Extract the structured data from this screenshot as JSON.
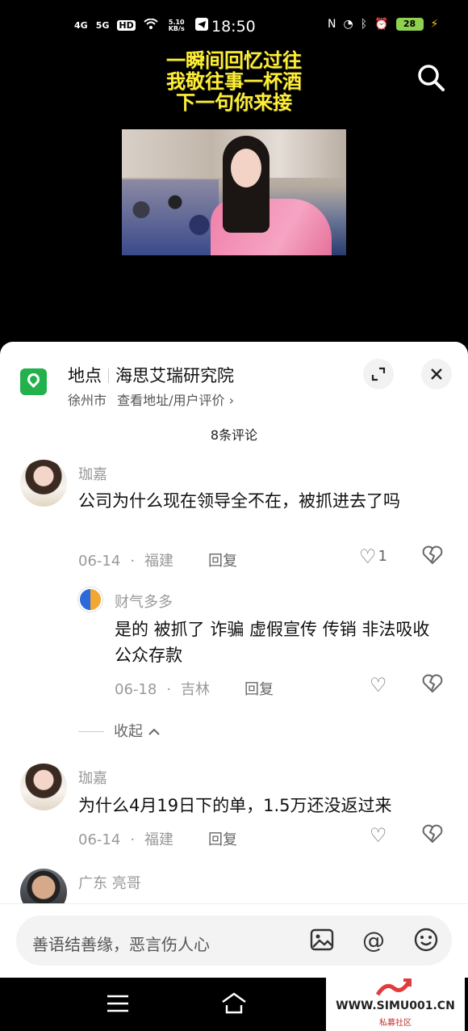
{
  "status_bar": {
    "net1": "4G",
    "net2": "5G",
    "hd": "HD",
    "speed": "5.10 KB/s",
    "time": "18:50",
    "battery": "28"
  },
  "video": {
    "caption_lines": [
      "一瞬间回忆过往",
      "我敬往事一杯酒",
      "下一句你来接"
    ]
  },
  "location": {
    "label": "地点",
    "name": "海思艾瑞研究院",
    "city": "徐州市",
    "link": "查看地址/用户评价 ›"
  },
  "comments_header": "8条评论",
  "comments": [
    {
      "name": "珈嘉",
      "text": "公司为什么现在领导全不在，被抓进去了吗",
      "date": "06-14",
      "region": "福建",
      "reply_label": "回复",
      "likes": "1"
    },
    {
      "name": "财气多多",
      "text": "是的 被抓了 诈骗 虚假宣传 传销 非法吸收公众存款",
      "date": "06-18",
      "region": "吉林",
      "reply_label": "回复"
    },
    {
      "name": "珈嘉",
      "text": "为什么4月19日下的单，1.5万还没返过来",
      "date": "06-14",
      "region": "福建",
      "reply_label": "回复"
    },
    {
      "name": "广东 亮哥"
    }
  ],
  "collapse_label": "收起",
  "input": {
    "placeholder": "善语结善缘，恶言伤人心"
  },
  "watermark": {
    "site": "WWW.SIMU001.CN",
    "sub": "私募社区"
  },
  "colors": {
    "caption": "#ffef33",
    "location_icon": "#22b14c",
    "battery": "#8fd14f"
  },
  "icons": [
    "search-icon",
    "location-pin-icon",
    "expand-icon",
    "close-icon",
    "heart-icon",
    "broken-heart-icon",
    "image-icon",
    "at-icon",
    "emoji-icon",
    "menu-icon",
    "home-icon"
  ]
}
